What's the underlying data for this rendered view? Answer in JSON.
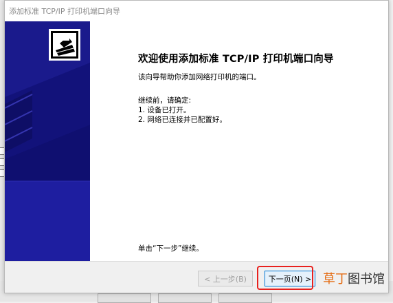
{
  "dialog": {
    "title": "添加标准 TCP/IP 打印机端口向导",
    "heading": "欢迎使用添加标准 TCP/IP 打印机端口向导",
    "intro": "该向导帮助你添加网络打印机的端口。",
    "before_label": "继续前，请确定:",
    "steps": [
      "1. 设备已打开。",
      "2. 网络已连接并已配置好。"
    ],
    "continue_hint": "单击“下一步”继续。",
    "buttons": {
      "back": "< 上一步(B)",
      "next": "下一页(N) >"
    }
  },
  "watermark": {
    "part1": "草",
    "part2": "丁",
    "part3": "图书馆"
  },
  "colors": {
    "banner_blue": "#1a1a8c",
    "highlight_red": "#e8201d"
  }
}
